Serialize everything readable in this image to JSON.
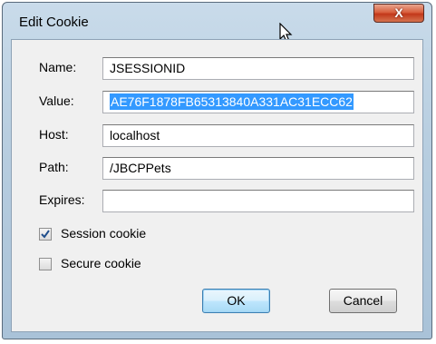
{
  "window": {
    "title": "Edit Cookie",
    "close_label": "X"
  },
  "form": {
    "name_label": "Name:",
    "name_value": "JSESSIONID",
    "value_label": "Value:",
    "value_value": "AE76F1878FB65313840A331AC31ECC62",
    "host_label": "Host:",
    "host_value": "localhost",
    "path_label": "Path:",
    "path_value": "/JBCPPets",
    "expires_label": "Expires:",
    "expires_value": ""
  },
  "options": {
    "session_cookie_label": "Session cookie",
    "session_cookie_checked": true,
    "secure_cookie_label": "Secure cookie",
    "secure_cookie_checked": false
  },
  "buttons": {
    "ok_label": "OK",
    "cancel_label": "Cancel"
  },
  "colors": {
    "selection": "#3399ff",
    "close_button": "#c2381a",
    "default_button_border": "#3c7fb1"
  },
  "icons": {
    "cursor": "arrow-cursor-icon",
    "checkmark": "checkmark-icon"
  }
}
